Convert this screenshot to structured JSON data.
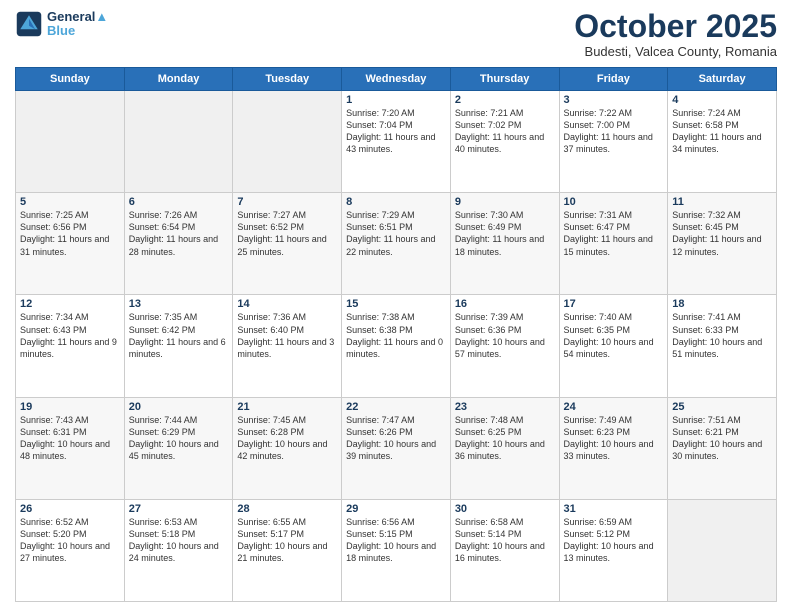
{
  "header": {
    "logo_line1": "General",
    "logo_line2": "Blue",
    "month": "October 2025",
    "location": "Budesti, Valcea County, Romania"
  },
  "weekdays": [
    "Sunday",
    "Monday",
    "Tuesday",
    "Wednesday",
    "Thursday",
    "Friday",
    "Saturday"
  ],
  "weeks": [
    [
      {
        "day": "",
        "sunrise": "",
        "sunset": "",
        "daylight": ""
      },
      {
        "day": "",
        "sunrise": "",
        "sunset": "",
        "daylight": ""
      },
      {
        "day": "",
        "sunrise": "",
        "sunset": "",
        "daylight": ""
      },
      {
        "day": "1",
        "sunrise": "Sunrise: 7:20 AM",
        "sunset": "Sunset: 7:04 PM",
        "daylight": "Daylight: 11 hours and 43 minutes."
      },
      {
        "day": "2",
        "sunrise": "Sunrise: 7:21 AM",
        "sunset": "Sunset: 7:02 PM",
        "daylight": "Daylight: 11 hours and 40 minutes."
      },
      {
        "day": "3",
        "sunrise": "Sunrise: 7:22 AM",
        "sunset": "Sunset: 7:00 PM",
        "daylight": "Daylight: 11 hours and 37 minutes."
      },
      {
        "day": "4",
        "sunrise": "Sunrise: 7:24 AM",
        "sunset": "Sunset: 6:58 PM",
        "daylight": "Daylight: 11 hours and 34 minutes."
      }
    ],
    [
      {
        "day": "5",
        "sunrise": "Sunrise: 7:25 AM",
        "sunset": "Sunset: 6:56 PM",
        "daylight": "Daylight: 11 hours and 31 minutes."
      },
      {
        "day": "6",
        "sunrise": "Sunrise: 7:26 AM",
        "sunset": "Sunset: 6:54 PM",
        "daylight": "Daylight: 11 hours and 28 minutes."
      },
      {
        "day": "7",
        "sunrise": "Sunrise: 7:27 AM",
        "sunset": "Sunset: 6:52 PM",
        "daylight": "Daylight: 11 hours and 25 minutes."
      },
      {
        "day": "8",
        "sunrise": "Sunrise: 7:29 AM",
        "sunset": "Sunset: 6:51 PM",
        "daylight": "Daylight: 11 hours and 22 minutes."
      },
      {
        "day": "9",
        "sunrise": "Sunrise: 7:30 AM",
        "sunset": "Sunset: 6:49 PM",
        "daylight": "Daylight: 11 hours and 18 minutes."
      },
      {
        "day": "10",
        "sunrise": "Sunrise: 7:31 AM",
        "sunset": "Sunset: 6:47 PM",
        "daylight": "Daylight: 11 hours and 15 minutes."
      },
      {
        "day": "11",
        "sunrise": "Sunrise: 7:32 AM",
        "sunset": "Sunset: 6:45 PM",
        "daylight": "Daylight: 11 hours and 12 minutes."
      }
    ],
    [
      {
        "day": "12",
        "sunrise": "Sunrise: 7:34 AM",
        "sunset": "Sunset: 6:43 PM",
        "daylight": "Daylight: 11 hours and 9 minutes."
      },
      {
        "day": "13",
        "sunrise": "Sunrise: 7:35 AM",
        "sunset": "Sunset: 6:42 PM",
        "daylight": "Daylight: 11 hours and 6 minutes."
      },
      {
        "day": "14",
        "sunrise": "Sunrise: 7:36 AM",
        "sunset": "Sunset: 6:40 PM",
        "daylight": "Daylight: 11 hours and 3 minutes."
      },
      {
        "day": "15",
        "sunrise": "Sunrise: 7:38 AM",
        "sunset": "Sunset: 6:38 PM",
        "daylight": "Daylight: 11 hours and 0 minutes."
      },
      {
        "day": "16",
        "sunrise": "Sunrise: 7:39 AM",
        "sunset": "Sunset: 6:36 PM",
        "daylight": "Daylight: 10 hours and 57 minutes."
      },
      {
        "day": "17",
        "sunrise": "Sunrise: 7:40 AM",
        "sunset": "Sunset: 6:35 PM",
        "daylight": "Daylight: 10 hours and 54 minutes."
      },
      {
        "day": "18",
        "sunrise": "Sunrise: 7:41 AM",
        "sunset": "Sunset: 6:33 PM",
        "daylight": "Daylight: 10 hours and 51 minutes."
      }
    ],
    [
      {
        "day": "19",
        "sunrise": "Sunrise: 7:43 AM",
        "sunset": "Sunset: 6:31 PM",
        "daylight": "Daylight: 10 hours and 48 minutes."
      },
      {
        "day": "20",
        "sunrise": "Sunrise: 7:44 AM",
        "sunset": "Sunset: 6:29 PM",
        "daylight": "Daylight: 10 hours and 45 minutes."
      },
      {
        "day": "21",
        "sunrise": "Sunrise: 7:45 AM",
        "sunset": "Sunset: 6:28 PM",
        "daylight": "Daylight: 10 hours and 42 minutes."
      },
      {
        "day": "22",
        "sunrise": "Sunrise: 7:47 AM",
        "sunset": "Sunset: 6:26 PM",
        "daylight": "Daylight: 10 hours and 39 minutes."
      },
      {
        "day": "23",
        "sunrise": "Sunrise: 7:48 AM",
        "sunset": "Sunset: 6:25 PM",
        "daylight": "Daylight: 10 hours and 36 minutes."
      },
      {
        "day": "24",
        "sunrise": "Sunrise: 7:49 AM",
        "sunset": "Sunset: 6:23 PM",
        "daylight": "Daylight: 10 hours and 33 minutes."
      },
      {
        "day": "25",
        "sunrise": "Sunrise: 7:51 AM",
        "sunset": "Sunset: 6:21 PM",
        "daylight": "Daylight: 10 hours and 30 minutes."
      }
    ],
    [
      {
        "day": "26",
        "sunrise": "Sunrise: 6:52 AM",
        "sunset": "Sunset: 5:20 PM",
        "daylight": "Daylight: 10 hours and 27 minutes."
      },
      {
        "day": "27",
        "sunrise": "Sunrise: 6:53 AM",
        "sunset": "Sunset: 5:18 PM",
        "daylight": "Daylight: 10 hours and 24 minutes."
      },
      {
        "day": "28",
        "sunrise": "Sunrise: 6:55 AM",
        "sunset": "Sunset: 5:17 PM",
        "daylight": "Daylight: 10 hours and 21 minutes."
      },
      {
        "day": "29",
        "sunrise": "Sunrise: 6:56 AM",
        "sunset": "Sunset: 5:15 PM",
        "daylight": "Daylight: 10 hours and 18 minutes."
      },
      {
        "day": "30",
        "sunrise": "Sunrise: 6:58 AM",
        "sunset": "Sunset: 5:14 PM",
        "daylight": "Daylight: 10 hours and 16 minutes."
      },
      {
        "day": "31",
        "sunrise": "Sunrise: 6:59 AM",
        "sunset": "Sunset: 5:12 PM",
        "daylight": "Daylight: 10 hours and 13 minutes."
      },
      {
        "day": "",
        "sunrise": "",
        "sunset": "",
        "daylight": ""
      }
    ]
  ]
}
